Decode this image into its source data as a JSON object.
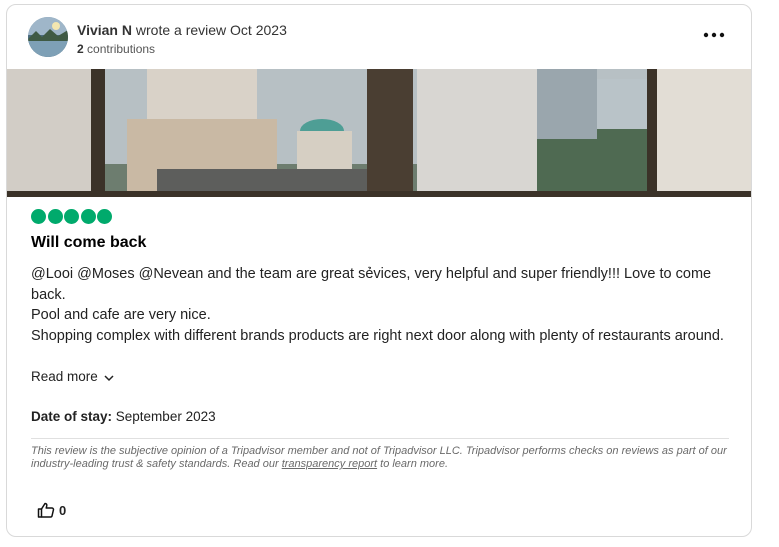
{
  "review": {
    "user_name": "Vivian N",
    "action": " wrote a review ",
    "date": "Oct 2023",
    "contributions_count": "2",
    "contributions_label": " contributions",
    "rating": 5,
    "title": "Will come back",
    "body": [
      "@Looi @Moses @Nevean and the team are great sẻvices, very helpful and super friendly!!! Love to come back.",
      "Pool and cafe are very nice.",
      "Shopping complex with different brands products are right next door along with plenty of restaurants around."
    ],
    "read_more": "Read more",
    "date_of_stay_label": "Date of stay:",
    "date_of_stay_value": " September 2023",
    "disclaimer_before": "This review is the subjective opinion of a Tripadvisor member and not of Tripadvisor LLC. Tripadvisor performs checks on reviews as part of our industry-leading trust & safety standards. Read our ",
    "disclaimer_link": "transparency report",
    "disclaimer_after": " to learn more.",
    "helpful_count": "0"
  },
  "icons": {
    "more": "more-options-icon",
    "thumb": "thumbs-up-icon",
    "chevron": "chevron-down-icon"
  },
  "colors": {
    "rating_green": "#00aa6c",
    "border": "#d9d9d9"
  }
}
